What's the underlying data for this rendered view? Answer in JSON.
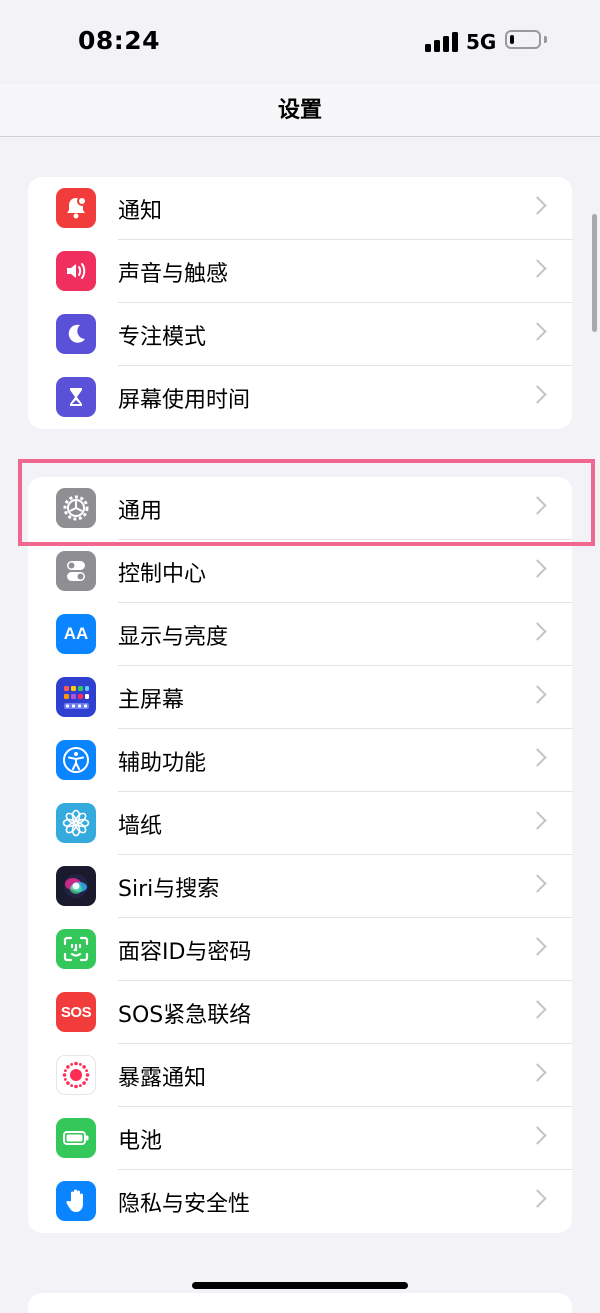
{
  "status_bar": {
    "time": "08:24",
    "network": "5G",
    "battery_level": 0.15
  },
  "nav": {
    "title": "设置"
  },
  "group1": [
    {
      "label": "通知",
      "icon": "bell-icon",
      "color": "#f23b3b"
    },
    {
      "label": "声音与触感",
      "icon": "speaker-icon",
      "color": "#f12f5e"
    },
    {
      "label": "专注模式",
      "icon": "moon-icon",
      "color": "#5b50d8"
    },
    {
      "label": "屏幕使用时间",
      "icon": "hourglass-icon",
      "color": "#5b50d8"
    }
  ],
  "group2": [
    {
      "label": "通用",
      "icon": "gear-icon",
      "color": "#8e8e93"
    },
    {
      "label": "控制中心",
      "icon": "toggles-icon",
      "color": "#8e8e93"
    },
    {
      "label": "显示与亮度",
      "icon": "text-size-icon",
      "color": "#0a84ff"
    },
    {
      "label": "主屏幕",
      "icon": "home-grid-icon",
      "color": "#2f3fd0"
    },
    {
      "label": "辅助功能",
      "icon": "accessibility-icon",
      "color": "#0a84ff"
    },
    {
      "label": "墙纸",
      "icon": "flower-icon",
      "color": "#35aadc"
    },
    {
      "label": "Siri与搜索",
      "icon": "siri-icon",
      "color": "#1a1a2e"
    },
    {
      "label": "面容ID与密码",
      "icon": "faceid-icon",
      "color": "#34c759"
    },
    {
      "label": "SOS紧急联络",
      "icon": "sos-icon",
      "color": "#f23b3b"
    },
    {
      "label": "暴露通知",
      "icon": "exposure-icon",
      "color": "#ffffff"
    },
    {
      "label": "电池",
      "icon": "battery-icon",
      "color": "#34c759"
    },
    {
      "label": "隐私与安全性",
      "icon": "hand-icon",
      "color": "#0a84ff"
    }
  ],
  "icon_text": {
    "display": "AA",
    "sos": "SOS"
  },
  "highlight_color": "#f0678f"
}
